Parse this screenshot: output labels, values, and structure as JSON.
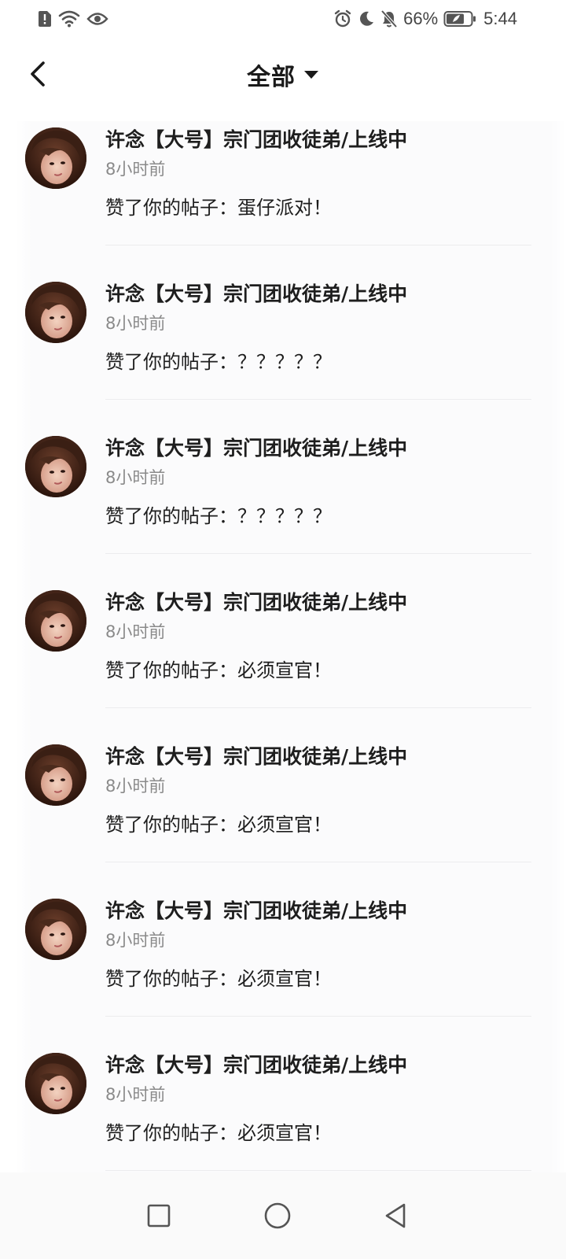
{
  "status_bar": {
    "battery_percent": "66%",
    "time": "5:44",
    "icons_left": [
      "alert-icon",
      "wifi-icon",
      "eye-icon"
    ],
    "icons_right": [
      "alarm-icon",
      "moon-icon",
      "bell-off-icon",
      "battery-icon"
    ]
  },
  "header": {
    "title": "全部",
    "back_icon": "chevron-left-icon",
    "dropdown_icon": "caret-down-icon"
  },
  "notifications": [
    {
      "username": "许念【大号】宗门团收徒弟/上线中",
      "time": "8小时前",
      "action": "赞了你的帖子：蛋仔派对！"
    },
    {
      "username": "许念【大号】宗门团收徒弟/上线中",
      "time": "8小时前",
      "action": "赞了你的帖子：？？？？？"
    },
    {
      "username": "许念【大号】宗门团收徒弟/上线中",
      "time": "8小时前",
      "action": "赞了你的帖子：？？？？？"
    },
    {
      "username": "许念【大号】宗门团收徒弟/上线中",
      "time": "8小时前",
      "action": "赞了你的帖子：必须宣官！"
    },
    {
      "username": "许念【大号】宗门团收徒弟/上线中",
      "time": "8小时前",
      "action": "赞了你的帖子：必须宣官！"
    },
    {
      "username": "许念【大号】宗门团收徒弟/上线中",
      "time": "8小时前",
      "action": "赞了你的帖子：必须宣官！"
    },
    {
      "username": "许念【大号】宗门团收徒弟/上线中",
      "time": "8小时前",
      "action": "赞了你的帖子：必须宣官！"
    }
  ],
  "nav_bar": {
    "buttons": [
      "recents-square-icon",
      "home-circle-icon",
      "back-triangle-icon"
    ]
  },
  "colors": {
    "text_primary": "#1e1e1e",
    "text_secondary": "#8a8a8a",
    "divider": "#ececee"
  }
}
